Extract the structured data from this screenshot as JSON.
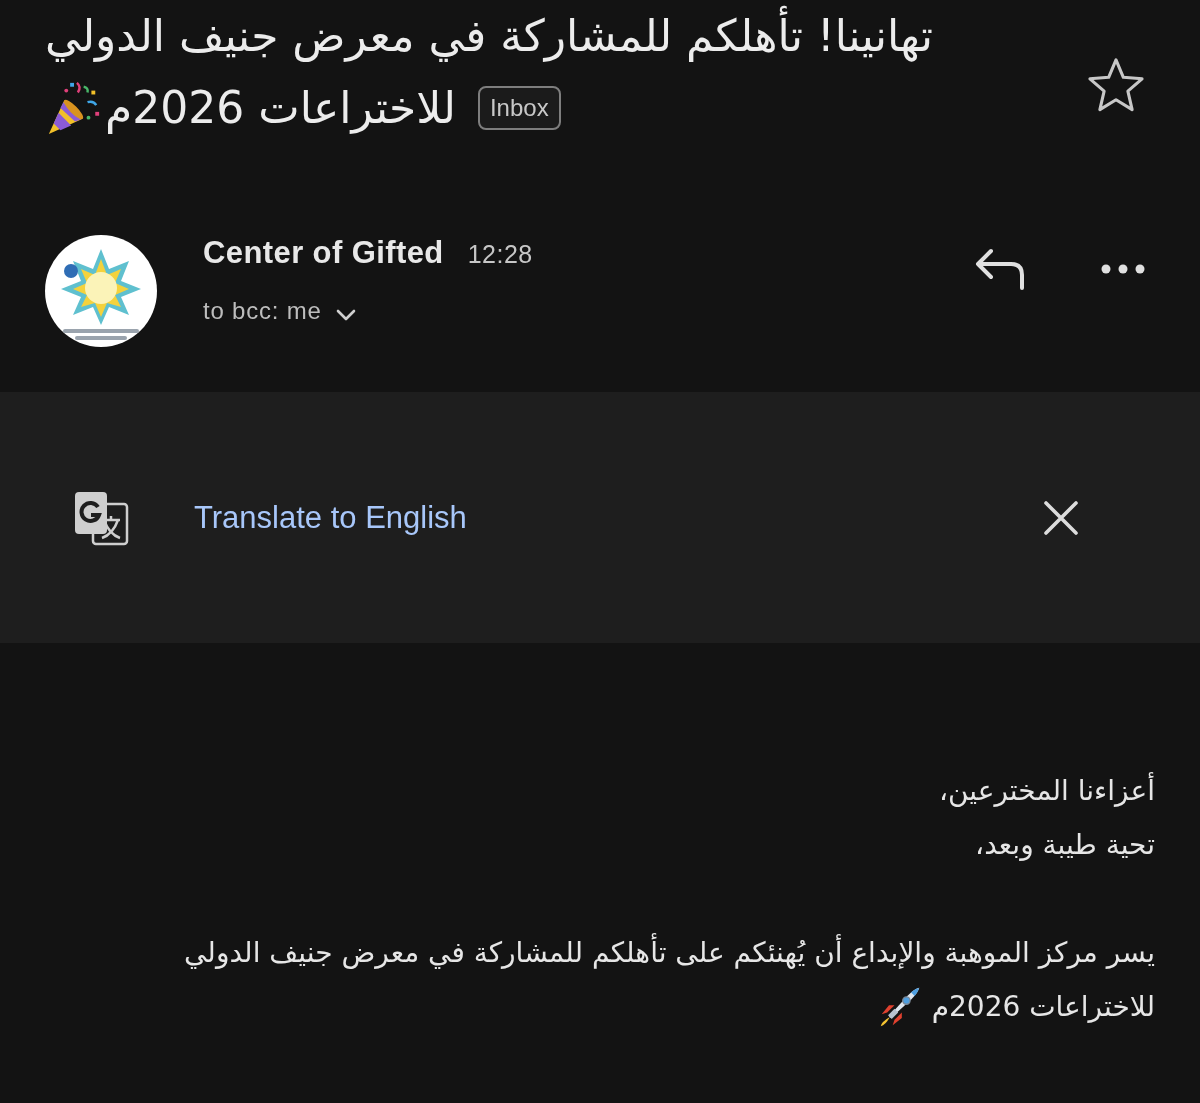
{
  "subject": {
    "lines": [
      "تهانينا! تأهلكم للمشاركة في معرض جنيف الدولي",
      "للاختراعات 2026م"
    ],
    "label": "Inbox",
    "starred": false
  },
  "sender": {
    "name": "Center of Gifted",
    "time": "12:28",
    "recipients": "to bcc: me"
  },
  "translate_bar": {
    "link": "Translate to English"
  },
  "body": {
    "greeting": [
      "أعزاءنا المخترعين،",
      "تحية طيبة وبعد،"
    ],
    "paragraph_lines": [
      "يسر مركز الموهبة والإبداع أن يُهنئكم على تأهلكم للمشاركة في معرض جنيف الدولي",
      "للاختراعات 2026م"
    ]
  }
}
